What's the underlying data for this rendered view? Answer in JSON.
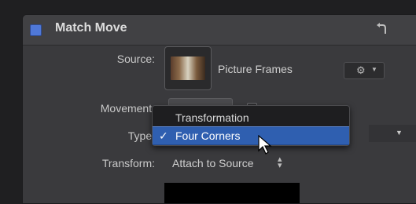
{
  "panel": {
    "title": "Match Move",
    "accent": "#4f78d8"
  },
  "rows": {
    "source_label": "Source:",
    "source_name": "Picture Frames",
    "movement_label": "Movement:",
    "type_label": "Type:",
    "transform_label": "Transform:",
    "transform_value": "Attach to Source"
  },
  "icons": {
    "reset": "reset-arrow-icon",
    "gear": "gear-icon",
    "gear_glyph": "⚙",
    "caret_glyph": "▼",
    "updown_glyph": "⇕"
  },
  "menu": {
    "items": [
      {
        "label": "Transformation",
        "selected": false
      },
      {
        "label": "Four Corners",
        "selected": true,
        "check": "✓"
      }
    ],
    "highlight": "#2f5fb0"
  }
}
